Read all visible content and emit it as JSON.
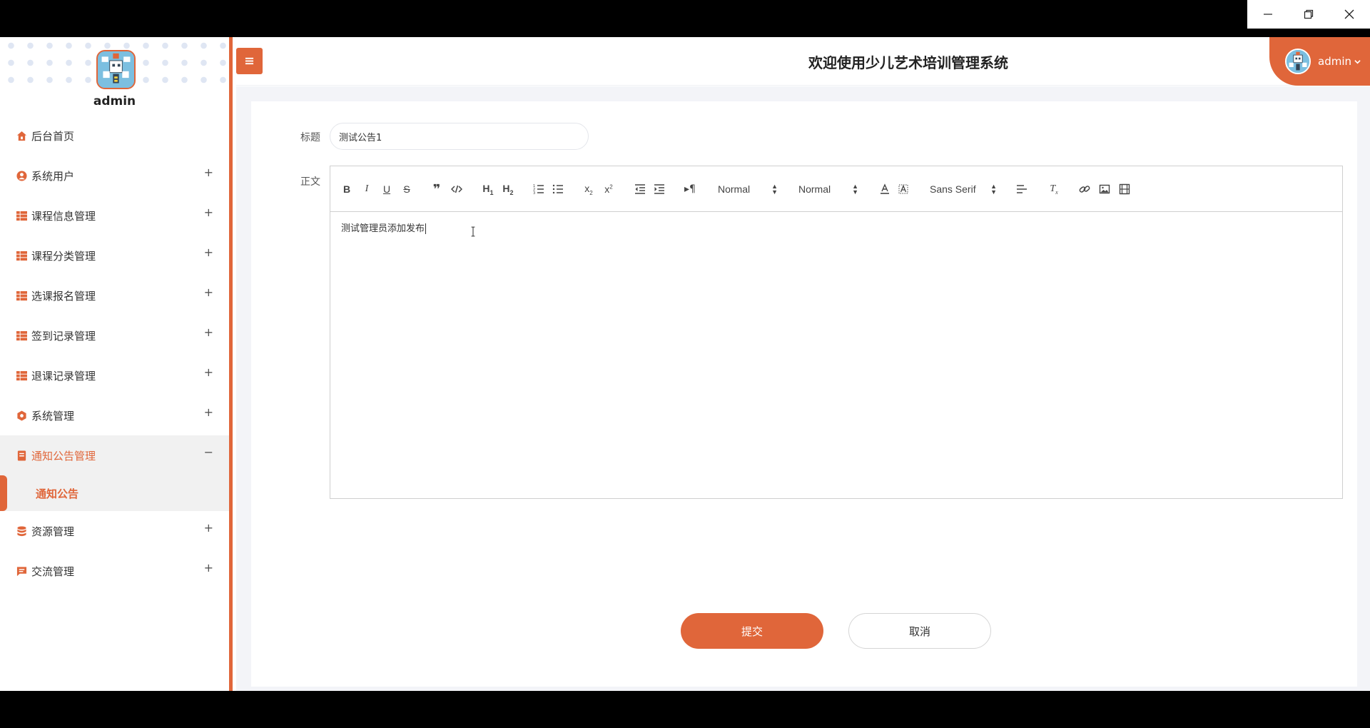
{
  "window": {
    "controls": [
      "minimize",
      "restore",
      "close"
    ]
  },
  "sidebar": {
    "username": "admin",
    "items": [
      {
        "label": "后台首页",
        "icon": "home-icon",
        "expandable": false
      },
      {
        "label": "系统用户",
        "icon": "user-icon",
        "expandable": true
      },
      {
        "label": "课程信息管理",
        "icon": "grid-icon",
        "expandable": true
      },
      {
        "label": "课程分类管理",
        "icon": "grid-icon",
        "expandable": true
      },
      {
        "label": "选课报名管理",
        "icon": "grid-icon",
        "expandable": true
      },
      {
        "label": "签到记录管理",
        "icon": "grid-icon",
        "expandable": true
      },
      {
        "label": "退课记录管理",
        "icon": "grid-icon",
        "expandable": true
      },
      {
        "label": "系统管理",
        "icon": "hexagon-icon",
        "expandable": true
      },
      {
        "label": "通知公告管理",
        "icon": "notice-icon",
        "expandable": true,
        "open": true
      },
      {
        "label": "资源管理",
        "icon": "database-icon",
        "expandable": true
      },
      {
        "label": "交流管理",
        "icon": "chat-icon",
        "expandable": true
      }
    ],
    "submenu": {
      "label": "通知公告"
    },
    "plus": "+",
    "minus": "−"
  },
  "header": {
    "title": "欢迎使用少儿艺术培训管理系统",
    "username": "admin"
  },
  "form": {
    "title_label": "标题",
    "title_value": "测试公告1",
    "body_label": "正文",
    "body_text": "测试管理员添加发布",
    "toolbar": {
      "size_picker": "Normal",
      "header_picker": "Normal",
      "font_picker": "Sans Serif"
    },
    "submit_label": "提交",
    "cancel_label": "取消"
  },
  "colors": {
    "accent": "#e0663a"
  }
}
